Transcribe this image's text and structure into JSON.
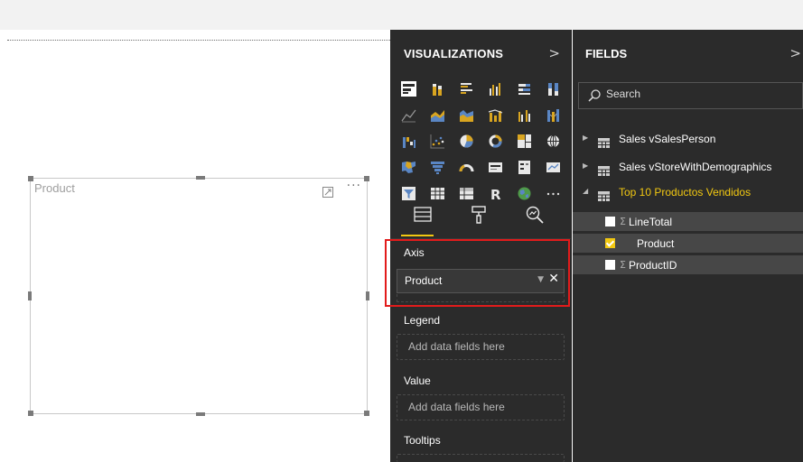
{
  "canvas": {
    "visual": {
      "title": "Product",
      "more_label": "···"
    }
  },
  "visualizations": {
    "header": "VISUALIZATIONS",
    "collapse_glyph": ">",
    "wells": [
      {
        "label": "Axis",
        "field": "Product",
        "remove_glyph": "✕"
      },
      {
        "label": "Legend",
        "placeholder": "Add data fields here"
      },
      {
        "label": "Value",
        "placeholder": "Add data fields here"
      },
      {
        "label": "Tooltips"
      }
    ],
    "icons": [
      [
        "stacked-bar-chart",
        "stacked-column-chart",
        "clustered-bar-chart",
        "clustered-column-chart",
        "100-percent-stacked-bar-chart",
        "100-percent-stacked-column-chart"
      ],
      [
        "line-chart",
        "area-chart",
        "stacked-area-chart",
        "line-and-stacked-column-chart",
        "line-and-clustered-column-chart",
        "ribbon-chart"
      ],
      [
        "waterfall-chart",
        "scatter-chart",
        "pie-chart",
        "donut-chart",
        "treemap",
        "map"
      ],
      [
        "filled-map",
        "funnel",
        "gauge",
        "card",
        "multi-row-card",
        "kpi"
      ],
      [
        "slicer",
        "table",
        "matrix",
        "r-script-visual",
        "globe",
        "more-visuals"
      ]
    ],
    "accent_color": "#f2c811",
    "highlight_color": "#e21b1b"
  },
  "fields": {
    "header": "FIELDS",
    "collapse_glyph": ">",
    "search_placeholder": "Search",
    "tables": [
      {
        "name": "Sales vSalesPerson",
        "expanded": false
      },
      {
        "name": "Sales vStoreWithDemographics",
        "expanded": false
      },
      {
        "name": "Top 10 Productos Vendidos",
        "expanded": true,
        "fields": [
          {
            "name": "LineTotal",
            "sigma": "Σ",
            "checked": false
          },
          {
            "name": "Product",
            "checked": true
          },
          {
            "name": "ProductID",
            "sigma": "Σ",
            "checked": false
          }
        ]
      }
    ]
  }
}
